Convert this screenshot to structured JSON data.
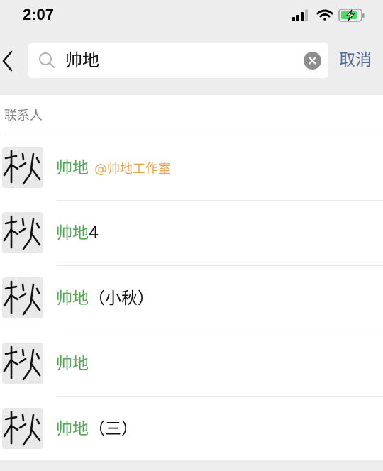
{
  "status_bar": {
    "time": "2:07",
    "icons": [
      "signal-icon",
      "wifi-icon",
      "battery-charging-icon"
    ]
  },
  "search": {
    "query": "帅地",
    "cancel_label": "取消"
  },
  "section": {
    "title": "联系人"
  },
  "contacts": [
    {
      "name_match": "帅地",
      "name_rest": "",
      "org": "@帅地工作室"
    },
    {
      "name_match": "帅地",
      "name_rest": "4",
      "org": ""
    },
    {
      "name_match": "帅地",
      "name_rest": "（小秋）",
      "org": ""
    },
    {
      "name_match": "帅地",
      "name_rest": "",
      "org": ""
    },
    {
      "name_match": "帅地",
      "name_rest": "（三）",
      "org": ""
    }
  ],
  "colors": {
    "match": "#57a55a",
    "org": "#e8a54e",
    "cancel": "#576b95",
    "background": "#ededed"
  }
}
